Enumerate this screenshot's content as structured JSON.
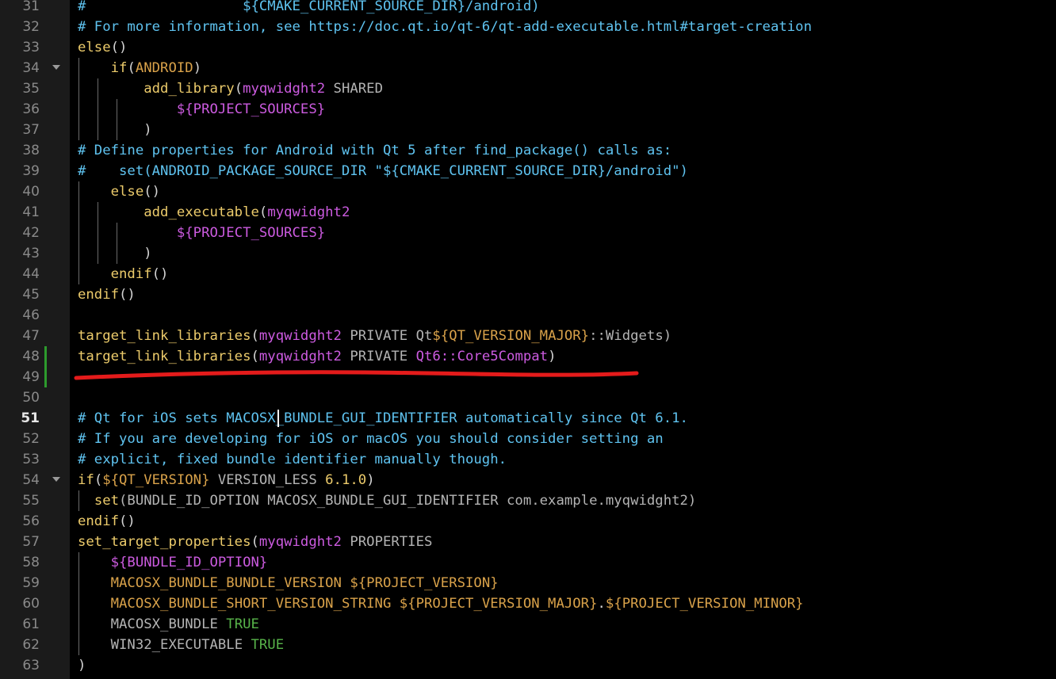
{
  "editor": {
    "current_line": 51,
    "colors": {
      "comment": "#5fc3f0",
      "function": "#eccb6b",
      "property": "#cc5be0",
      "variable": "#d9a24a",
      "true": "#58b44a",
      "modified_marker": "#2d9b2d",
      "annotation_underline": "#e41b1b"
    },
    "lines": [
      {
        "num": "31",
        "guides": 0,
        "tokens": [
          {
            "t": "#                   ${CMAKE_CURRENT_SOURCE_DIR}/android)",
            "c": "cm"
          }
        ]
      },
      {
        "num": "32",
        "guides": 0,
        "tokens": [
          {
            "t": "# For more information, see https://doc.qt.io/qt-6/qt-add-executable.html#target-creation",
            "c": "cm"
          }
        ]
      },
      {
        "num": "33",
        "guides": 0,
        "tokens": [
          {
            "t": "else",
            "c": "fn"
          },
          {
            "t": "()",
            "c": "pl"
          }
        ]
      },
      {
        "num": "34",
        "guides": 1,
        "fold": true,
        "tokens": [
          {
            "t": "    ",
            "c": "pl"
          },
          {
            "t": "if",
            "c": "fn"
          },
          {
            "t": "(",
            "c": "pl"
          },
          {
            "t": "ANDROID",
            "c": "va"
          },
          {
            "t": ")",
            "c": "pl"
          }
        ]
      },
      {
        "num": "35",
        "guides": 2,
        "tokens": [
          {
            "t": "        ",
            "c": "pl"
          },
          {
            "t": "add_library",
            "c": "fn"
          },
          {
            "t": "(",
            "c": "pl"
          },
          {
            "t": "myqwidght2",
            "c": "pr"
          },
          {
            "t": " SHARED",
            "c": "kw"
          }
        ]
      },
      {
        "num": "36",
        "guides": 3,
        "tokens": [
          {
            "t": "            ",
            "c": "pl"
          },
          {
            "t": "${PROJECT_SOURCES}",
            "c": "pr"
          }
        ]
      },
      {
        "num": "37",
        "guides": 3,
        "tokens": [
          {
            "t": "        )",
            "c": "pl"
          }
        ]
      },
      {
        "num": "38",
        "guides": 0,
        "tokens": [
          {
            "t": "# Define properties for Android with Qt 5 after find_package() calls as:",
            "c": "cm"
          }
        ]
      },
      {
        "num": "39",
        "guides": 0,
        "tokens": [
          {
            "t": "#    set(ANDROID_PACKAGE_SOURCE_DIR \"${CMAKE_CURRENT_SOURCE_DIR}/android\")",
            "c": "cm"
          }
        ]
      },
      {
        "num": "40",
        "guides": 1,
        "tokens": [
          {
            "t": "    ",
            "c": "pl"
          },
          {
            "t": "else",
            "c": "fn"
          },
          {
            "t": "()",
            "c": "pl"
          }
        ]
      },
      {
        "num": "41",
        "guides": 2,
        "tokens": [
          {
            "t": "        ",
            "c": "pl"
          },
          {
            "t": "add_executable",
            "c": "fn"
          },
          {
            "t": "(",
            "c": "pl"
          },
          {
            "t": "myqwidght2",
            "c": "pr"
          }
        ]
      },
      {
        "num": "42",
        "guides": 3,
        "tokens": [
          {
            "t": "            ",
            "c": "pl"
          },
          {
            "t": "${PROJECT_SOURCES}",
            "c": "pr"
          }
        ]
      },
      {
        "num": "43",
        "guides": 3,
        "tokens": [
          {
            "t": "        )",
            "c": "pl"
          }
        ]
      },
      {
        "num": "44",
        "guides": 1,
        "tokens": [
          {
            "t": "    ",
            "c": "pl"
          },
          {
            "t": "endif",
            "c": "fn"
          },
          {
            "t": "()",
            "c": "pl"
          }
        ]
      },
      {
        "num": "45",
        "guides": 0,
        "tokens": [
          {
            "t": "endif",
            "c": "fn"
          },
          {
            "t": "()",
            "c": "pl"
          }
        ]
      },
      {
        "num": "46",
        "guides": 0,
        "tokens": []
      },
      {
        "num": "47",
        "guides": 0,
        "tokens": [
          {
            "t": "target_link_libraries",
            "c": "fn"
          },
          {
            "t": "(",
            "c": "pl"
          },
          {
            "t": "myqwidght2",
            "c": "pr"
          },
          {
            "t": " PRIVATE Qt",
            "c": "kw"
          },
          {
            "t": "${QT_VERSION_MAJOR}",
            "c": "va"
          },
          {
            "t": "::Widgets)",
            "c": "kw"
          }
        ]
      },
      {
        "num": "48",
        "guides": 0,
        "mod": true,
        "tokens": [
          {
            "t": "target_link_libraries",
            "c": "fn"
          },
          {
            "t": "(",
            "c": "pl"
          },
          {
            "t": "myqwidght2",
            "c": "pr"
          },
          {
            "t": " PRIVATE ",
            "c": "kw"
          },
          {
            "t": "Qt6::Core5Compat",
            "c": "pr"
          },
          {
            "t": ")",
            "c": "pl"
          }
        ]
      },
      {
        "num": "49",
        "guides": 0,
        "mod": true,
        "tokens": []
      },
      {
        "num": "50",
        "guides": 0,
        "tokens": []
      },
      {
        "num": "51",
        "guides": 0,
        "current": true,
        "tokens": [
          {
            "t": "# Qt for iOS sets MACOSX_BUNDLE_GUI_IDENTIFIER automatically since Qt 6.1.",
            "c": "cm"
          }
        ]
      },
      {
        "num": "52",
        "guides": 0,
        "tokens": [
          {
            "t": "# If you are developing for iOS or macOS you should consider setting an",
            "c": "cm"
          }
        ]
      },
      {
        "num": "53",
        "guides": 0,
        "tokens": [
          {
            "t": "# explicit, fixed bundle identifier manually though.",
            "c": "cm"
          }
        ]
      },
      {
        "num": "54",
        "guides": 0,
        "fold": true,
        "tokens": [
          {
            "t": "if",
            "c": "fn"
          },
          {
            "t": "(",
            "c": "pl"
          },
          {
            "t": "${QT_VERSION}",
            "c": "va"
          },
          {
            "t": " VERSION_LESS ",
            "c": "kw"
          },
          {
            "t": "6.1.0",
            "c": "fn"
          },
          {
            "t": ")",
            "c": "pl"
          }
        ]
      },
      {
        "num": "55",
        "guides": 1,
        "tokens": [
          {
            "t": "  ",
            "c": "pl"
          },
          {
            "t": "set",
            "c": "fn"
          },
          {
            "t": "(BUNDLE_ID_OPTION MACOSX_BUNDLE_GUI_IDENTIFIER com.example.myqwidght2)",
            "c": "kw"
          }
        ]
      },
      {
        "num": "56",
        "guides": 0,
        "tokens": [
          {
            "t": "endif",
            "c": "fn"
          },
          {
            "t": "()",
            "c": "pl"
          }
        ]
      },
      {
        "num": "57",
        "guides": 0,
        "tokens": [
          {
            "t": "set_target_properties",
            "c": "fn"
          },
          {
            "t": "(",
            "c": "pl"
          },
          {
            "t": "myqwidght2",
            "c": "pr"
          },
          {
            "t": " PROPERTIES",
            "c": "kw"
          }
        ]
      },
      {
        "num": "58",
        "guides": 1,
        "tokens": [
          {
            "t": "    ",
            "c": "pl"
          },
          {
            "t": "${BUNDLE_ID_OPTION}",
            "c": "pr"
          }
        ]
      },
      {
        "num": "59",
        "guides": 1,
        "tokens": [
          {
            "t": "    ",
            "c": "pl"
          },
          {
            "t": "MACOSX_BUNDLE_BUNDLE_VERSION ",
            "c": "va"
          },
          {
            "t": "${PROJECT_VERSION}",
            "c": "va"
          }
        ]
      },
      {
        "num": "60",
        "guides": 1,
        "tokens": [
          {
            "t": "    ",
            "c": "pl"
          },
          {
            "t": "MACOSX_BUNDLE_SHORT_VERSION_STRING ",
            "c": "va"
          },
          {
            "t": "${PROJECT_VERSION_MAJOR}",
            "c": "va"
          },
          {
            "t": ".",
            "c": "pl"
          },
          {
            "t": "${PROJECT_VERSION_MINOR}",
            "c": "va"
          }
        ]
      },
      {
        "num": "61",
        "guides": 1,
        "tokens": [
          {
            "t": "    ",
            "c": "pl"
          },
          {
            "t": "MACOSX_BUNDLE ",
            "c": "kw"
          },
          {
            "t": "TRUE",
            "c": "tr"
          }
        ]
      },
      {
        "num": "62",
        "guides": 1,
        "tokens": [
          {
            "t": "    ",
            "c": "pl"
          },
          {
            "t": "WIN32_EXECUTABLE ",
            "c": "kw"
          },
          {
            "t": "TRUE",
            "c": "tr"
          }
        ]
      },
      {
        "num": "63",
        "guides": 0,
        "tokens": [
          {
            "t": ")",
            "c": "pl"
          }
        ]
      }
    ]
  }
}
